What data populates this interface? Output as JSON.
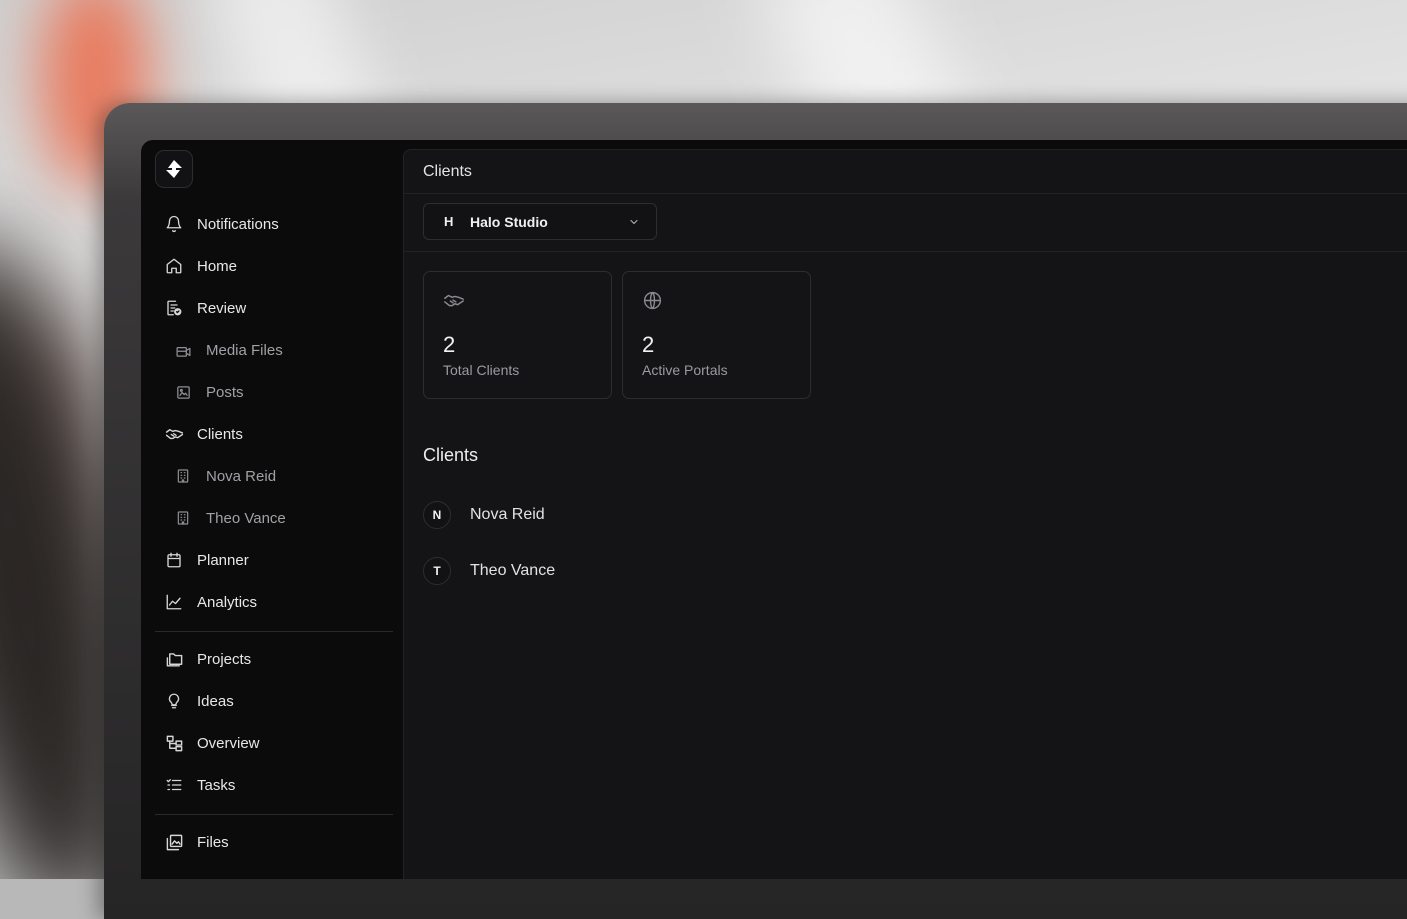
{
  "sidebar": {
    "items": [
      {
        "label": "Notifications",
        "icon": "bell-icon"
      },
      {
        "label": "Home",
        "icon": "home-icon"
      },
      {
        "label": "Review",
        "icon": "review-document-icon"
      },
      {
        "label": "Media Files",
        "icon": "media-files-icon"
      },
      {
        "label": "Posts",
        "icon": "image-post-icon"
      },
      {
        "label": "Clients",
        "icon": "handshake-icon"
      },
      {
        "label": "Nova Reid",
        "icon": "building-icon"
      },
      {
        "label": "Theo Vance",
        "icon": "building-icon"
      },
      {
        "label": "Planner",
        "icon": "calendar-icon"
      },
      {
        "label": "Analytics",
        "icon": "line-chart-icon"
      },
      {
        "label": "Projects",
        "icon": "folders-icon"
      },
      {
        "label": "Ideas",
        "icon": "lightbulb-icon"
      },
      {
        "label": "Overview",
        "icon": "hierarchy-icon"
      },
      {
        "label": "Tasks",
        "icon": "checklist-icon"
      },
      {
        "label": "Files",
        "icon": "image-library-icon"
      }
    ]
  },
  "header": {
    "breadcrumb": "Clients"
  },
  "workspace_select": {
    "initial": "H",
    "name": "Halo Studio"
  },
  "stats": [
    {
      "value": "2",
      "label": "Total Clients",
      "icon": "handshake-icon"
    },
    {
      "value": "2",
      "label": "Active Portals",
      "icon": "globe-icon"
    }
  ],
  "clients_section": {
    "title": "Clients",
    "clients": [
      {
        "initial": "N",
        "name": "Nova Reid"
      },
      {
        "initial": "T",
        "name": "Theo Vance"
      }
    ]
  },
  "colors": {
    "background": "#0b0b0c",
    "panel": "#141416",
    "border": "#2d2d30",
    "text": "#e8e8ea"
  }
}
